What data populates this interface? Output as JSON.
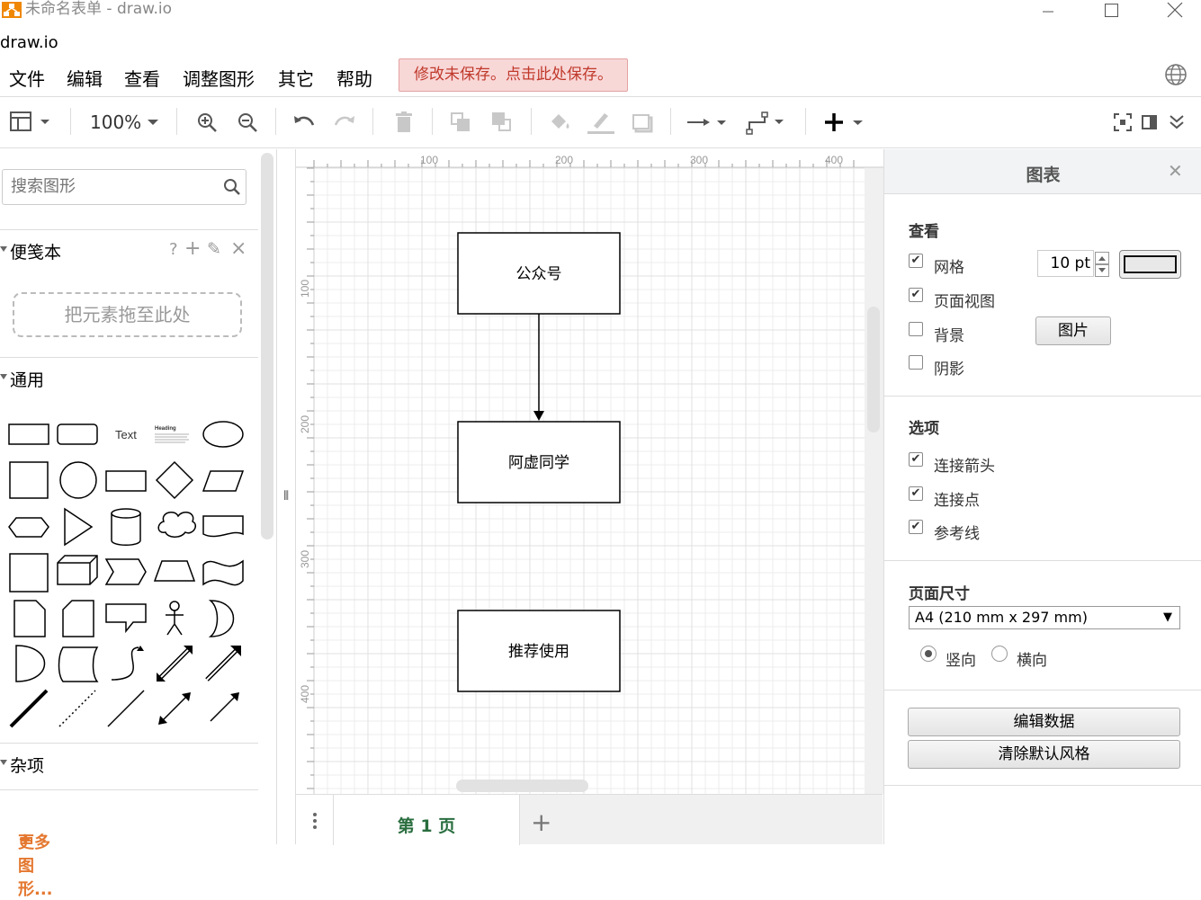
{
  "window": {
    "title": "未命名表单 - draw.io",
    "app_name": "draw.io"
  },
  "menu": {
    "items": [
      "文件",
      "编辑",
      "查看",
      "调整图形",
      "其它",
      "帮助"
    ],
    "unsaved_notice": "修改未保存。点击此处保存。"
  },
  "toolbar": {
    "zoom": "100%",
    "icons": [
      "format-panel-icon",
      "zoom-in-icon",
      "zoom-out-icon",
      "undo-icon",
      "redo-icon",
      "delete-icon",
      "to-front-icon",
      "to-back-icon",
      "fill-color-icon",
      "line-color-icon",
      "shadow-icon",
      "connection-icon",
      "waypoints-icon",
      "insert-icon",
      "fullscreen-icon",
      "toggle-panel-icon",
      "collapse-icon"
    ]
  },
  "left_panel": {
    "search_placeholder": "搜索图形",
    "scratchpad_title": "便笺本",
    "scratchpad_icons": [
      "?",
      "+",
      "✎",
      "×"
    ],
    "dropzone_text": "把元素拖至此处",
    "general_title": "通用",
    "misc_title": "杂项",
    "more_shapes": "更多图形...",
    "sample_text": "Text",
    "sample_heading": "Heading"
  },
  "canvas": {
    "ruler_top": [
      "100",
      "200",
      "300",
      "400"
    ],
    "ruler_left": [
      "100",
      "200",
      "300",
      "400"
    ],
    "nodes": [
      "公众号",
      "阿虚同学",
      "推荐使用"
    ]
  },
  "pages": {
    "tabs": [
      "第 1 页"
    ]
  },
  "right_panel": {
    "title": "图表",
    "view_title": "查看",
    "grid_label": "网格",
    "grid_value": "10 pt",
    "pageview_label": "页面视图",
    "background_label": "背景",
    "image_button": "图片",
    "shadow_label": "阴影",
    "options_title": "选项",
    "connection_arrows": "连接箭头",
    "connection_points": "连接点",
    "guides": "参考线",
    "page_size_title": "页面尺寸",
    "page_size_value": "A4 (210 mm x 297 mm)",
    "portrait": "竖向",
    "landscape": "横向",
    "edit_data": "编辑数据",
    "clear_style": "清除默认风格",
    "checked": {
      "grid": true,
      "pageview": true,
      "background": false,
      "shadow": false,
      "connection_arrows": true,
      "connection_points": true,
      "guides": true
    }
  }
}
